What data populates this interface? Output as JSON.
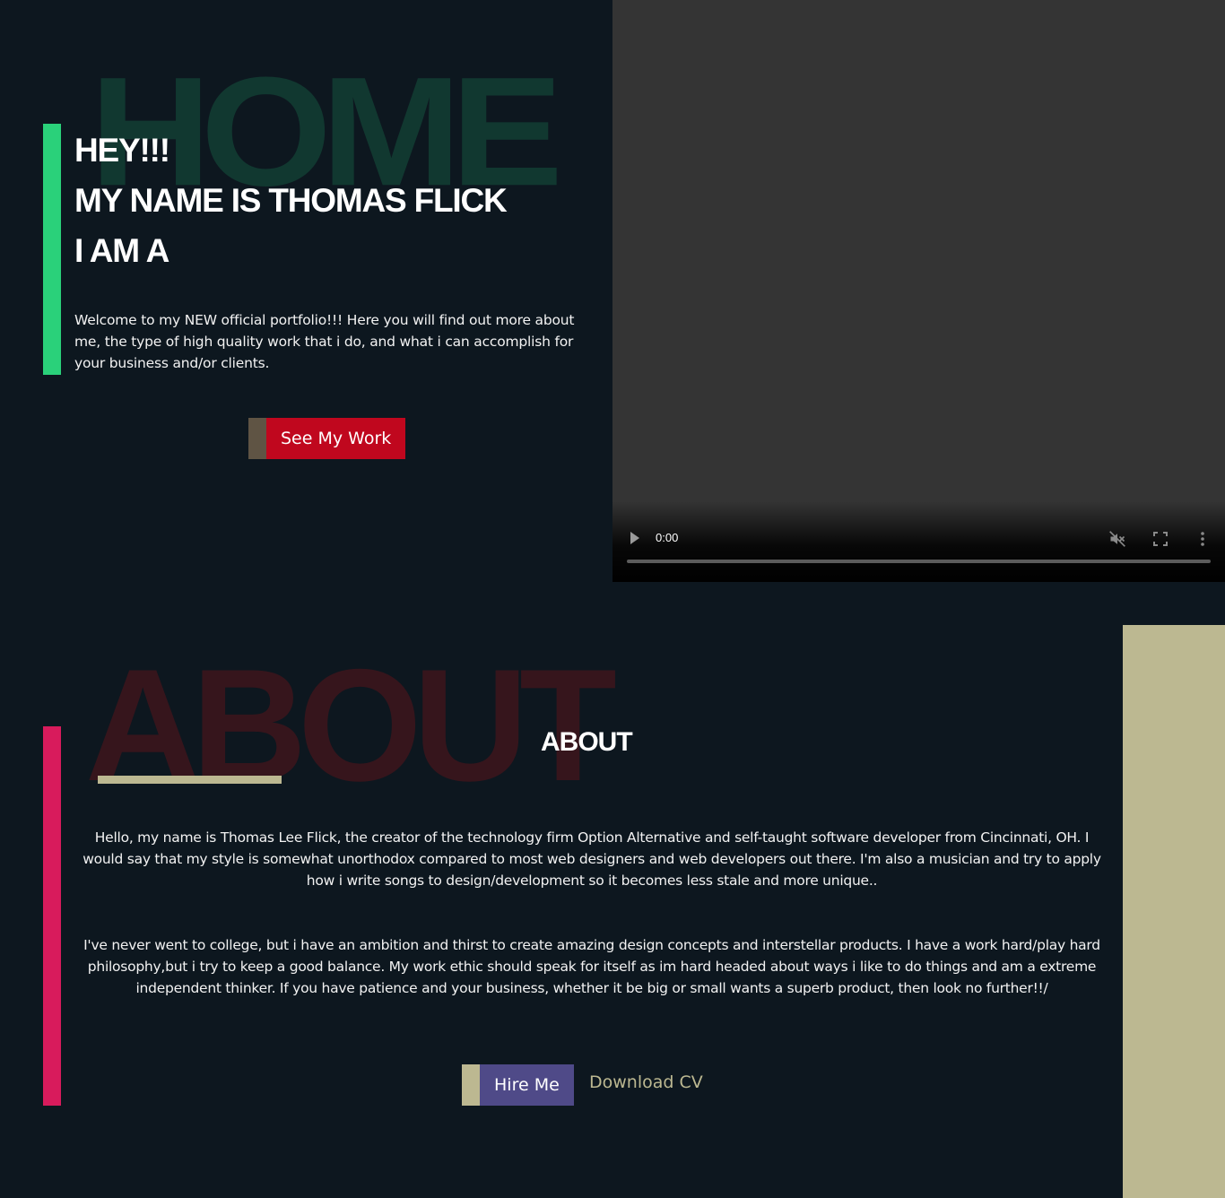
{
  "home": {
    "bg_word": "HOME",
    "greeting": "HEY!!!",
    "name_line": "MY NAME IS THOMAS FLICK",
    "role_line": "I AM A",
    "intro": "Welcome to my NEW official portfolio!!! Here you will find out more about me, the type of high quality work that i do, and what i can accomplish for your business and/or clients.",
    "cta_label": "See My Work"
  },
  "video": {
    "time": "0:00",
    "icons": [
      "play-icon",
      "mute-icon",
      "fullscreen-icon",
      "more-icon"
    ],
    "progress": 0
  },
  "about": {
    "bg_word": "ABOUT",
    "title": "ABOUT",
    "paragraph_1": "Hello, my name is Thomas Lee Flick, the creator of the technology firm Option Alternative and self-taught software developer from Cincinnati, OH. I would say that my style is somewhat unorthodox compared to most web designers and web developers out there. I'm also a musician and try to apply how i write songs to design/development so it becomes less stale and more unique..",
    "paragraph_2": "I've never went to college, but i have an ambition and thirst to create amazing design concepts and interstellar products. I have a work hard/play hard philosophy,but i try to keep a good balance. My work ethic should speak for itself as im hard headed about ways i like to do things and am a extreme independent thinker. If you have patience and your business, whether it be big or small wants a superb product, then look no further!!/",
    "hire_label": "Hire Me",
    "download_label": "Download CV"
  },
  "colors": {
    "background": "#0d171f",
    "home_accent": "#2ad17a",
    "about_accent": "#d81b5c",
    "cta_red": "#c0071e",
    "hire_purple": "#4f4a88",
    "khaki": "#bcb891"
  }
}
